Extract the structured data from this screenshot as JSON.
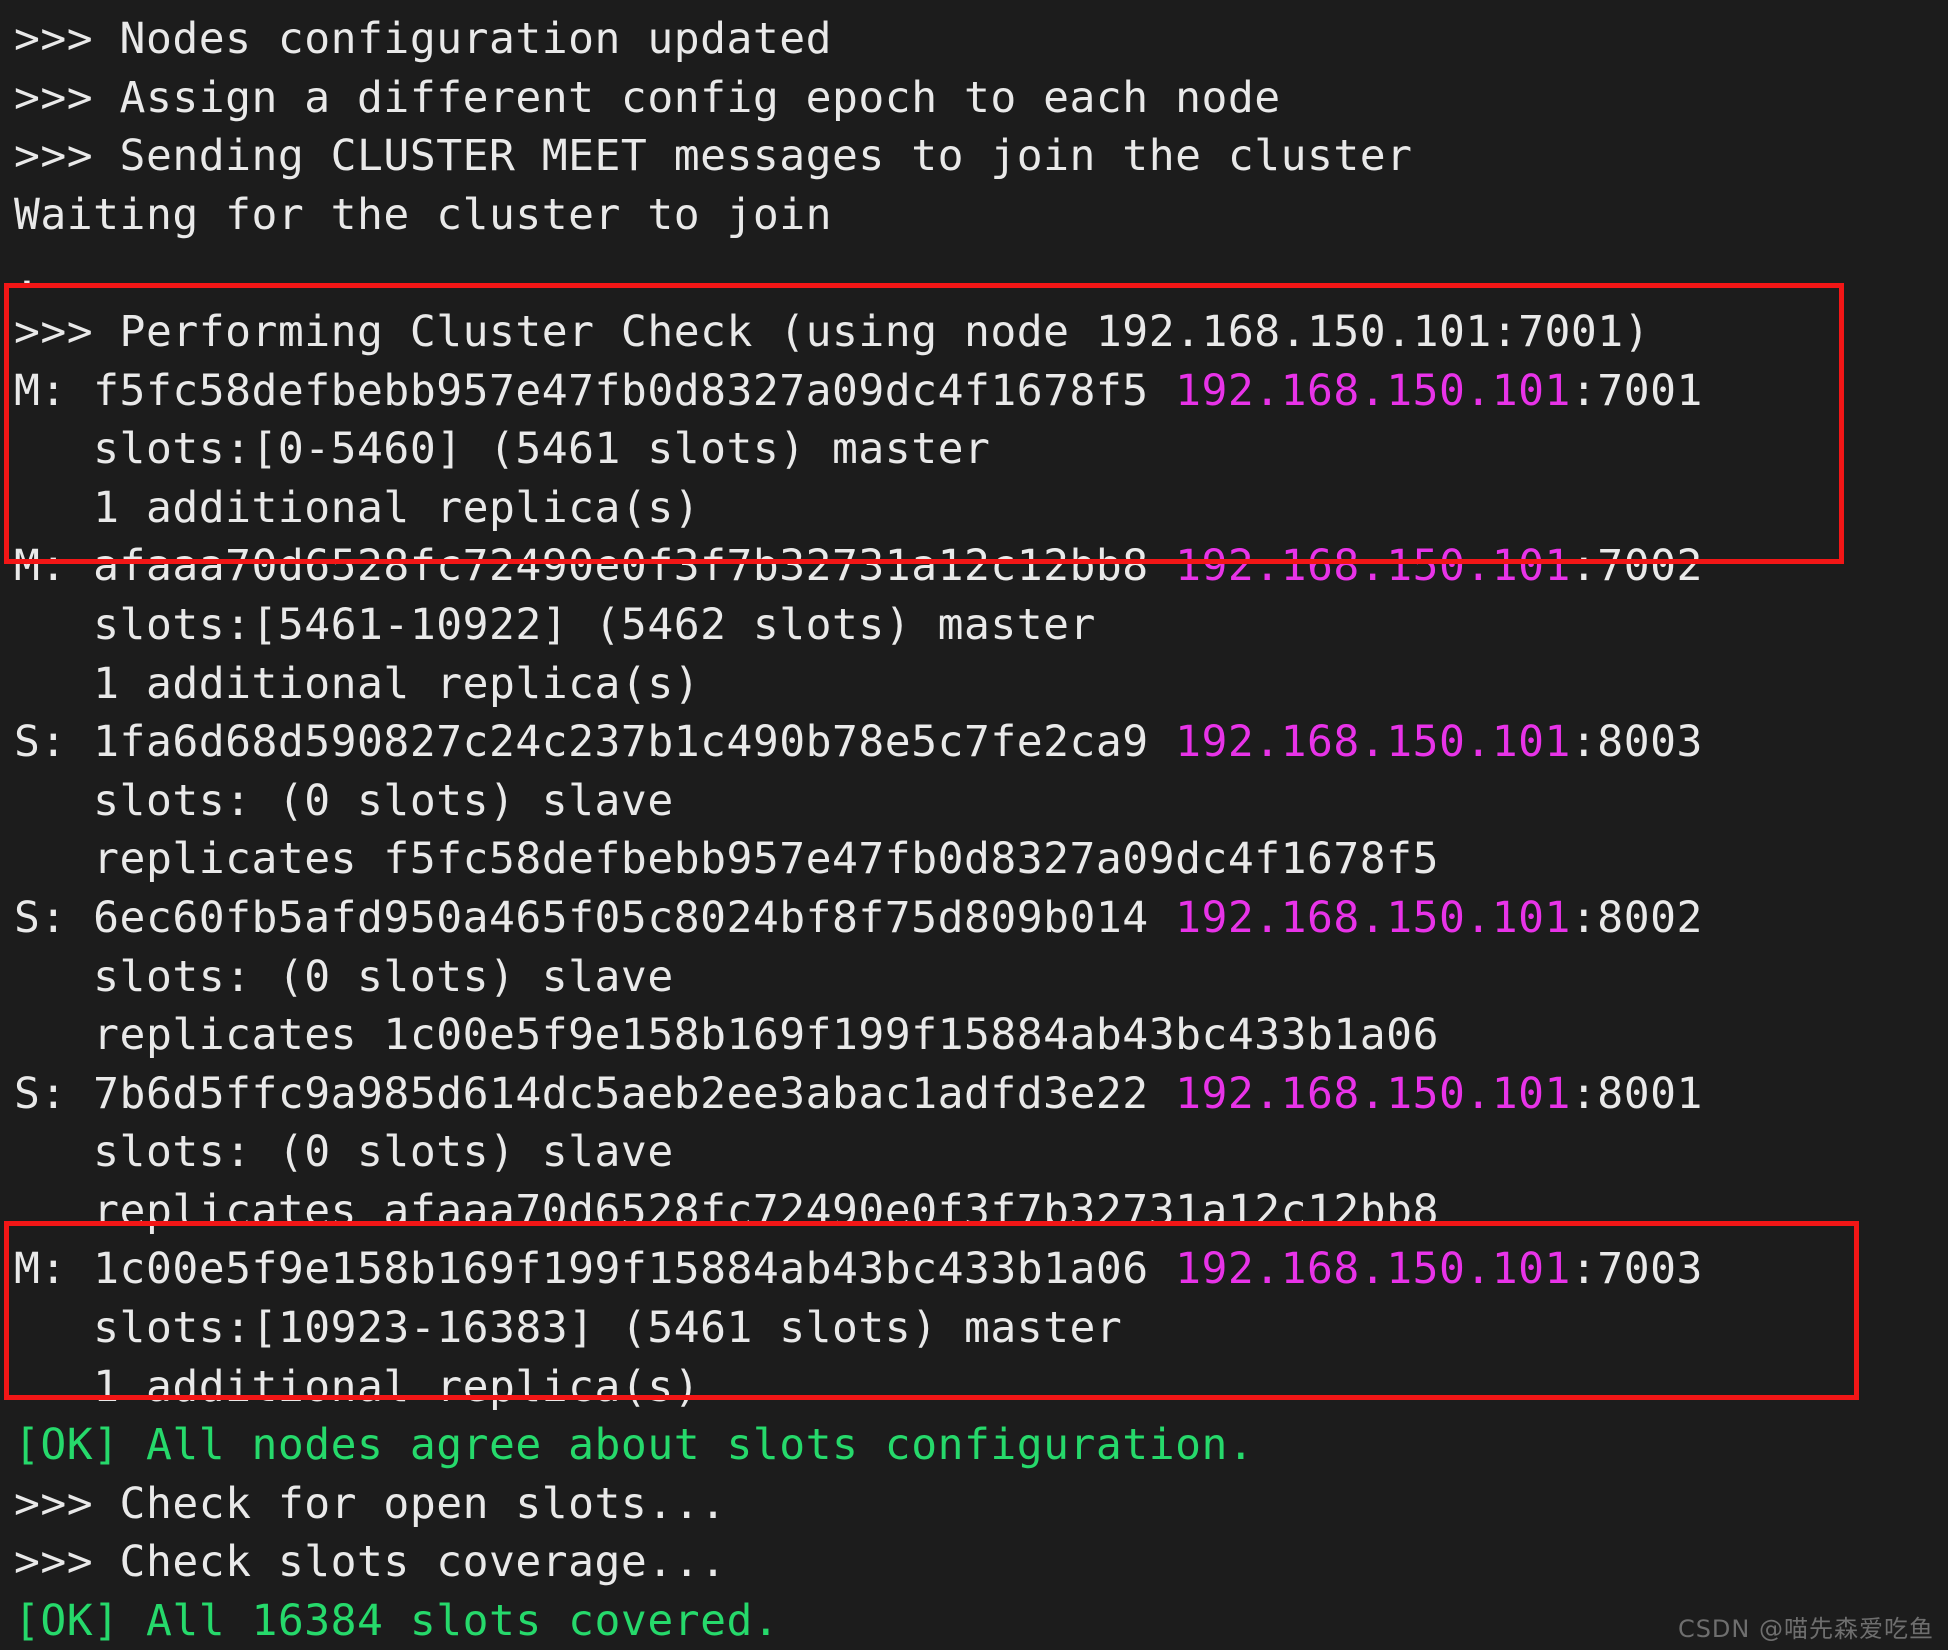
{
  "terminal": {
    "background_color": "#1c1c1c",
    "default_text_color": "#e9e9e9",
    "magenta_color": "#e833e8",
    "green_color": "#26d96b",
    "annotation_color": "#f21616",
    "lines": [
      {
        "segments": [
          {
            "text": ">>> Nodes configuration updated",
            "color": "white"
          }
        ]
      },
      {
        "segments": [
          {
            "text": ">>> Assign a different config epoch to each node",
            "color": "white"
          }
        ]
      },
      {
        "segments": [
          {
            "text": ">>> Sending CLUSTER MEET messages to join the cluster",
            "color": "white"
          }
        ]
      },
      {
        "segments": [
          {
            "text": "Waiting for the cluster to join",
            "color": "white"
          }
        ]
      },
      {
        "segments": [
          {
            "text": ".",
            "color": "white"
          }
        ]
      },
      {
        "segments": [
          {
            "text": ">>> Performing Cluster Check (using node 192.168.150.101:7001)",
            "color": "white"
          }
        ]
      },
      {
        "segments": [
          {
            "text": "M: f5fc58defbebb957e47fb0d8327a09dc4f1678f5 ",
            "color": "white"
          },
          {
            "text": "192.168.150.101",
            "color": "magenta"
          },
          {
            "text": ":7001",
            "color": "white"
          }
        ]
      },
      {
        "segments": [
          {
            "text": "   slots:[0-5460] (5461 slots) master",
            "color": "white"
          }
        ]
      },
      {
        "segments": [
          {
            "text": "   1 additional replica(s)",
            "color": "white"
          }
        ]
      },
      {
        "segments": [
          {
            "text": "M: afaaa70d6528fc72490e0f3f7b32731a12c12bb8 ",
            "color": "white"
          },
          {
            "text": "192.168.150.101",
            "color": "magenta"
          },
          {
            "text": ":7002",
            "color": "white"
          }
        ]
      },
      {
        "segments": [
          {
            "text": "   slots:[5461-10922] (5462 slots) master",
            "color": "white"
          }
        ]
      },
      {
        "segments": [
          {
            "text": "   1 additional replica(s)",
            "color": "white"
          }
        ]
      },
      {
        "segments": [
          {
            "text": "S: 1fa6d68d590827c24c237b1c490b78e5c7fe2ca9 ",
            "color": "white"
          },
          {
            "text": "192.168.150.101",
            "color": "magenta"
          },
          {
            "text": ":8003",
            "color": "white"
          }
        ]
      },
      {
        "segments": [
          {
            "text": "   slots: (0 slots) slave",
            "color": "white"
          }
        ]
      },
      {
        "segments": [
          {
            "text": "   replicates f5fc58defbebb957e47fb0d8327a09dc4f1678f5",
            "color": "white"
          }
        ]
      },
      {
        "segments": [
          {
            "text": "S: 6ec60fb5afd950a465f05c8024bf8f75d809b014 ",
            "color": "white"
          },
          {
            "text": "192.168.150.101",
            "color": "magenta"
          },
          {
            "text": ":8002",
            "color": "white"
          }
        ]
      },
      {
        "segments": [
          {
            "text": "   slots: (0 slots) slave",
            "color": "white"
          }
        ]
      },
      {
        "segments": [
          {
            "text": "   replicates 1c00e5f9e158b169f199f15884ab43bc433b1a06",
            "color": "white"
          }
        ]
      },
      {
        "segments": [
          {
            "text": "S: 7b6d5ffc9a985d614dc5aeb2ee3abac1adfd3e22 ",
            "color": "white"
          },
          {
            "text": "192.168.150.101",
            "color": "magenta"
          },
          {
            "text": ":8001",
            "color": "white"
          }
        ]
      },
      {
        "segments": [
          {
            "text": "   slots: (0 slots) slave",
            "color": "white"
          }
        ]
      },
      {
        "segments": [
          {
            "text": "   replicates afaaa70d6528fc72490e0f3f7b32731a12c12bb8",
            "color": "white"
          }
        ]
      },
      {
        "segments": [
          {
            "text": "M: 1c00e5f9e158b169f199f15884ab43bc433b1a06 ",
            "color": "white"
          },
          {
            "text": "192.168.150.101",
            "color": "magenta"
          },
          {
            "text": ":7003",
            "color": "white"
          }
        ]
      },
      {
        "segments": [
          {
            "text": "   slots:[10923-16383] (5461 slots) master",
            "color": "white"
          }
        ]
      },
      {
        "segments": [
          {
            "text": "   1 additional replica(s)",
            "color": "white"
          }
        ]
      },
      {
        "segments": [
          {
            "text": "[OK] All nodes agree about slots configuration.",
            "color": "green"
          }
        ]
      },
      {
        "segments": [
          {
            "text": ">>> Check for open slots...",
            "color": "white"
          }
        ]
      },
      {
        "segments": [
          {
            "text": ">>> Check slots coverage...",
            "color": "white"
          }
        ]
      },
      {
        "segments": [
          {
            "text": "[OK] All 16384 slots covered.",
            "color": "green"
          }
        ]
      }
    ]
  },
  "annotations": {
    "box_top_label": "masters-7001-7002-highlight",
    "box_bottom_label": "master-7003-highlight"
  },
  "watermark": {
    "text": "CSDN @喵先森爱吃鱼"
  }
}
